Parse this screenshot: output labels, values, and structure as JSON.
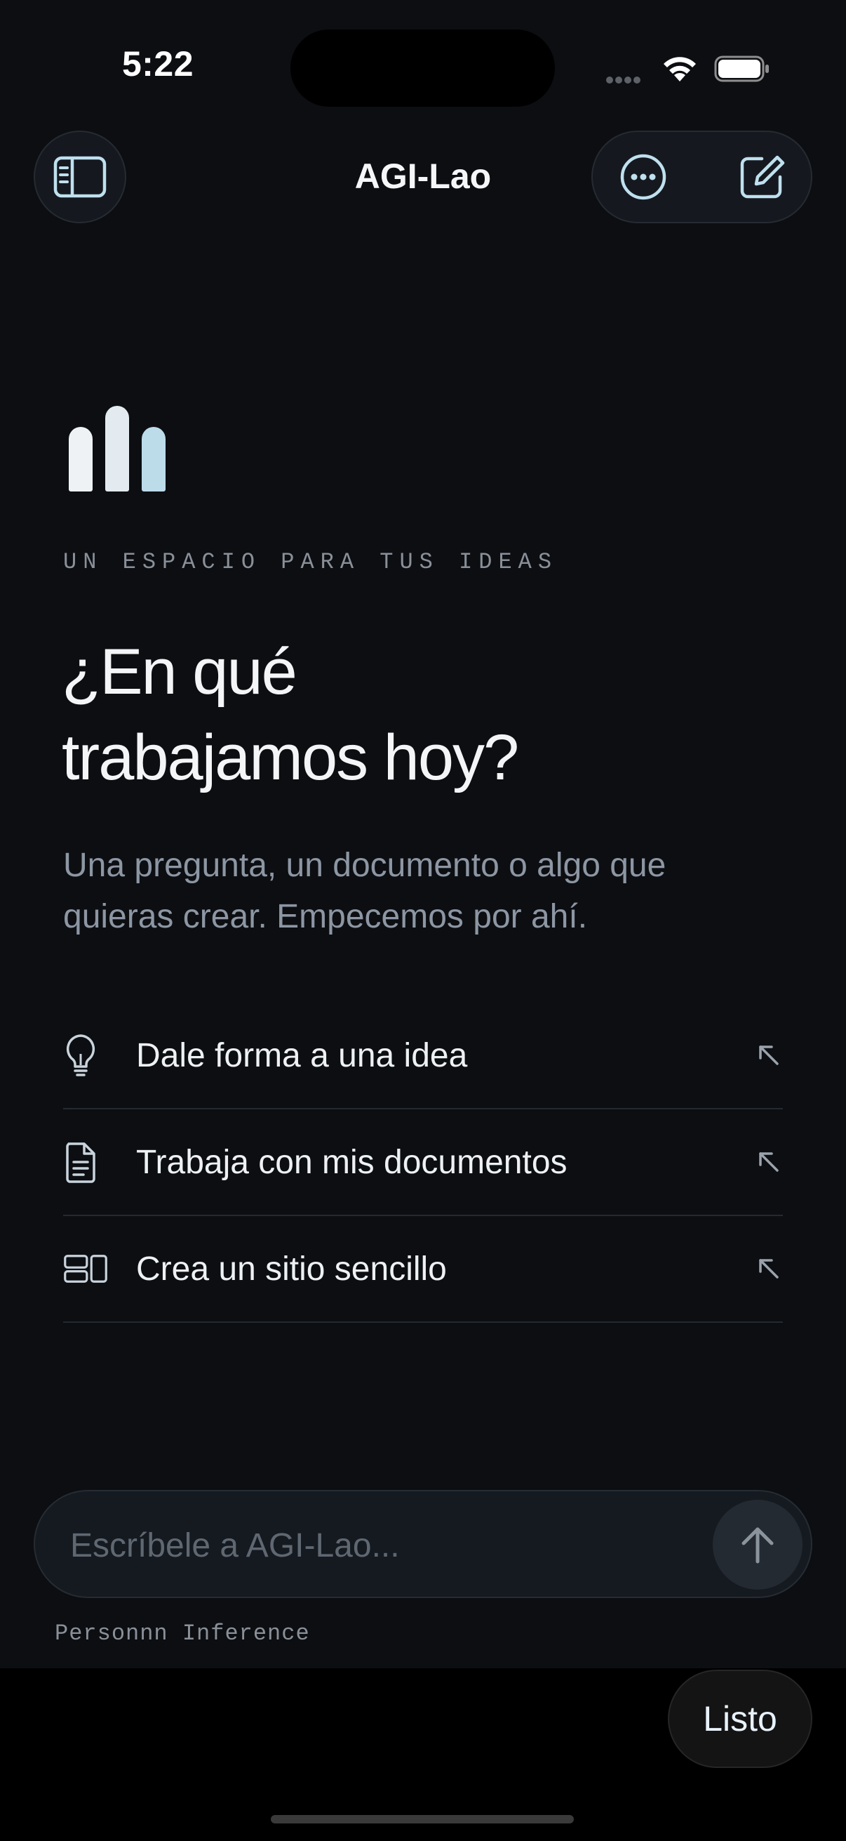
{
  "status_bar": {
    "time": "5:22",
    "icons": [
      "cellular-signal-icon",
      "wifi-icon",
      "battery-icon"
    ]
  },
  "header": {
    "title": "AGI-Lao",
    "left_icon": "sidebar-icon",
    "right_icons": [
      "more-options-icon",
      "compose-icon"
    ]
  },
  "hero": {
    "logo": "equalizer-bars-logo",
    "eyebrow": "UN ESPACIO PARA TUS IDEAS",
    "headline_line1": "¿En qué",
    "headline_line2": "trabajamos hoy?",
    "subtitle_line1": "Una pregunta, un documento o algo que",
    "subtitle_line2": "quieras crear. Empecemos por ahí."
  },
  "suggestions": [
    {
      "label": "Dale forma a una idea",
      "icon": "lightbulb-icon"
    },
    {
      "label": "Trabaja con mis documentos",
      "icon": "document-icon"
    },
    {
      "label": "Crea un sitio sencillo",
      "icon": "layout-icon"
    }
  ],
  "composer": {
    "placeholder": "Escríbele a AGI-Lao...",
    "value": "",
    "send_icon": "arrow-up-icon"
  },
  "footer_note": "Personnn Inference",
  "keyboard_toolbar": {
    "done_label": "Listo"
  },
  "colors": {
    "background": "#0c0e12",
    "accent": "#bfe0ee",
    "muted_text": "#8d96a3",
    "divider": "#252a31"
  }
}
